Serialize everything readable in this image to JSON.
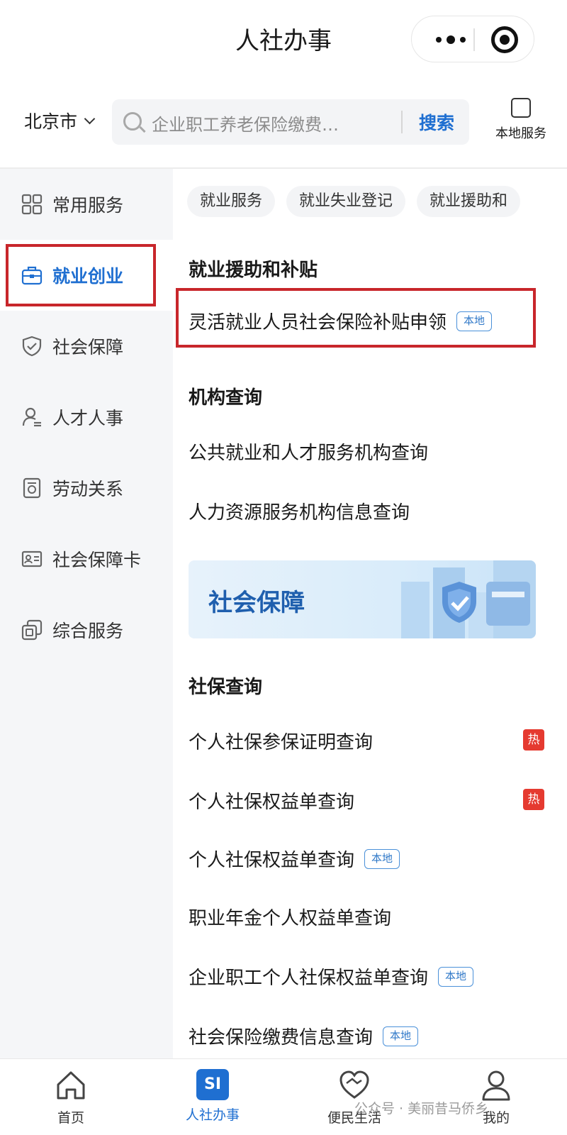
{
  "titlebar": {
    "title": "人社办事"
  },
  "search": {
    "city": "北京市",
    "placeholder": "企业职工养老保险缴费…",
    "button": "搜索",
    "local_service": "本地服务"
  },
  "sidebar": {
    "items": [
      {
        "label": "常用服务",
        "icon": "grid-icon"
      },
      {
        "label": "就业创业",
        "icon": "briefcase-icon",
        "active": true
      },
      {
        "label": "社会保障",
        "icon": "shield-icon"
      },
      {
        "label": "人才人事",
        "icon": "person-icon"
      },
      {
        "label": "劳动关系",
        "icon": "document-icon"
      },
      {
        "label": "社会保障卡",
        "icon": "id-card-icon"
      },
      {
        "label": "综合服务",
        "icon": "copy-icon"
      }
    ]
  },
  "chips": [
    "就业服务",
    "就业失业登记",
    "就业援助和"
  ],
  "sections": {
    "employment_aid": {
      "title": "就业援助和补贴",
      "items": [
        {
          "label": "灵活就业人员社会保险补贴申领",
          "tag": "本地"
        }
      ]
    },
    "agency_query": {
      "title": "机构查询",
      "items": [
        {
          "label": "公共就业和人才服务机构查询"
        },
        {
          "label": "人力资源服务机构信息查询"
        }
      ]
    },
    "banner": {
      "title": "社会保障"
    },
    "social_insurance_query": {
      "title": "社保查询",
      "items": [
        {
          "label": "个人社保参保证明查询",
          "hot": "热"
        },
        {
          "label": "个人社保权益单查询",
          "hot": "热"
        },
        {
          "label": "个人社保权益单查询",
          "tag": "本地"
        },
        {
          "label": "职业年金个人权益单查询"
        },
        {
          "label": "企业职工个人社保权益单查询",
          "tag": "本地"
        },
        {
          "label": "社会保险缴费信息查询",
          "tag": "本地"
        }
      ]
    }
  },
  "tabbar": {
    "items": [
      {
        "label": "首页",
        "icon": "home-icon"
      },
      {
        "label": "人社办事",
        "icon": "si-icon",
        "badge": "SI",
        "active": true
      },
      {
        "label": "便民生活",
        "icon": "handshake-heart-icon"
      },
      {
        "label": "我的",
        "icon": "user-icon"
      }
    ]
  },
  "watermark": "公众号 · 美丽昔马侨乡",
  "colors": {
    "accent": "#1f6fd1",
    "highlight_box": "#c8262b",
    "hot": "#e53a30",
    "sidebar_bg": "#f5f6f8"
  }
}
